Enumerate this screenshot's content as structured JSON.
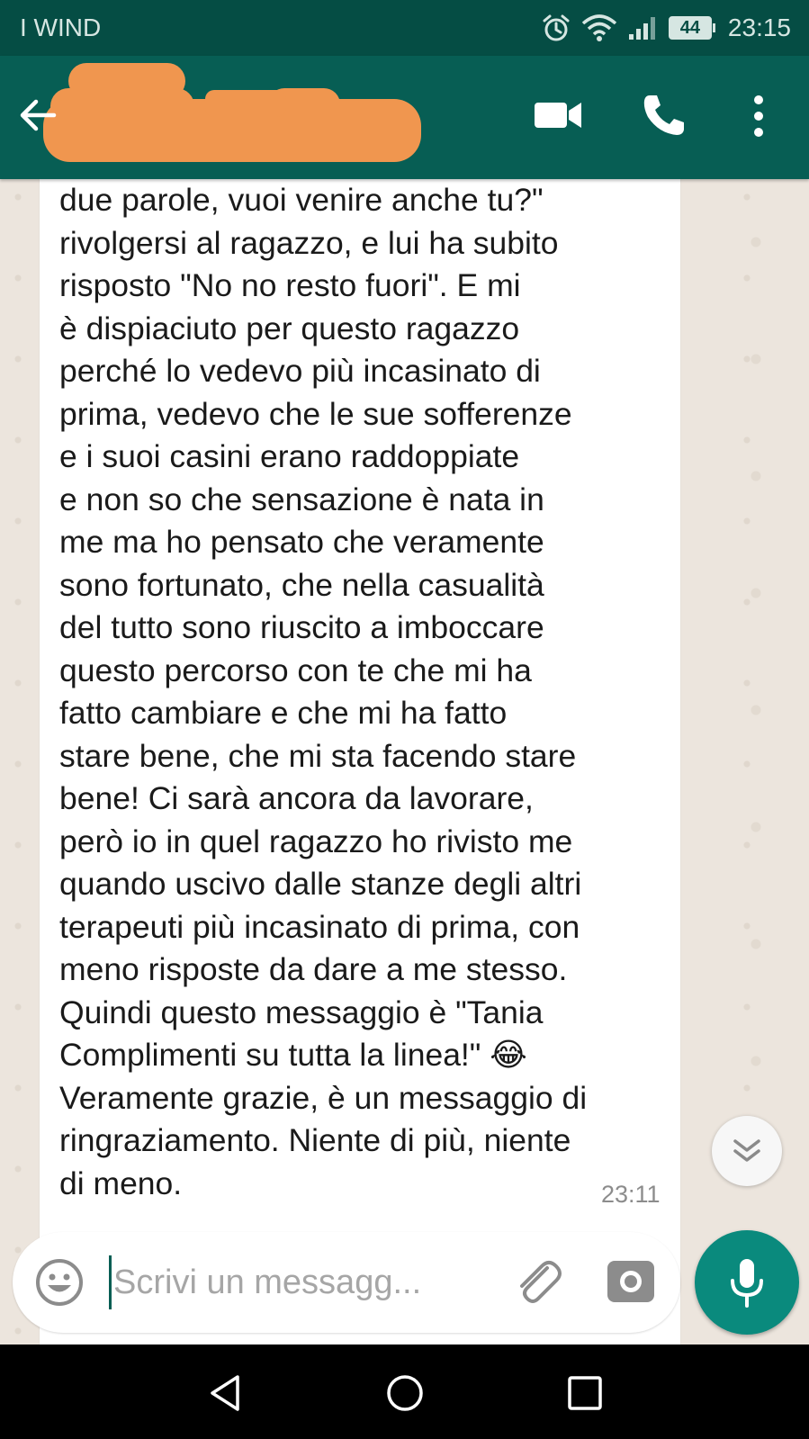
{
  "status_bar": {
    "carrier": "I WIND",
    "battery": "44",
    "time": "23:15",
    "icons": [
      "alarm-icon",
      "wifi-icon",
      "signal-icon",
      "battery-icon"
    ]
  },
  "header": {
    "icons": [
      "back-arrow-icon",
      "video-call-icon",
      "phone-icon",
      "more-vert-icon"
    ]
  },
  "message": {
    "text": "due parole, vuoi venire anche tu?\"\nrivolgersi al ragazzo, e lui ha subito\nrisposto \"No no resto fuori\". E mi\nè dispiaciuto per questo ragazzo\nperché lo vedevo più incasinato di\nprima, vedevo che le sue sofferenze\ne i suoi casini erano raddoppiate\ne non so che sensazione è nata in\nme ma ho pensato che veramente\nsono fortunato, che nella casualità\ndel tutto sono riuscito a imboccare\nquesto percorso con te che mi ha\nfatto cambiare e che mi ha fatto\nstare bene, che mi sta facendo stare\nbene! Ci sarà ancora da lavorare,\nperò io in quel ragazzo ho rivisto me\nquando uscivo dalle stanze degli altri\nterapeuti più incasinato di prima, con\nmeno risposte da dare a me stesso.\nQuindi questo messaggio è \"Tania\nComplimenti su tutta la linea!\" 😂\nVeramente grazie, è un messaggio di\nringraziamento. Niente di più, niente\ndi meno.",
    "time": "23:11"
  },
  "input": {
    "placeholder": "Scrivi un messagg..."
  },
  "colors": {
    "status_bar": "#054d44",
    "header": "#075e54",
    "accent": "#0a8a7d",
    "chat_background": "#ece5dd",
    "redaction": "#f0964f"
  }
}
